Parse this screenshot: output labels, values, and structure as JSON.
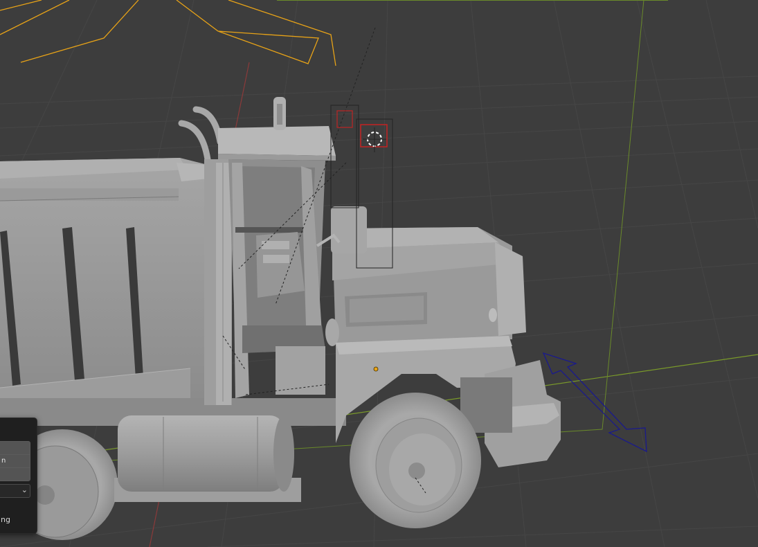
{
  "app": "3D viewport",
  "viewport": {
    "background": "#3d3d3d",
    "grid_color": "#4a4a4a",
    "x_axis_color": "#7a9a2a",
    "y_axis_color": "#8b3a3a",
    "selection_color": "#e8a317",
    "gizmo_color": "#1a1a8c"
  },
  "operator_panel": {
    "field_text": "n",
    "label_text": "ng",
    "select_chevron": "⌄"
  },
  "icons": {
    "camera": "camera-wireframe-icon",
    "light": "spot-light-icon",
    "cursor": "3d-cursor-icon",
    "origin": "origin-dot-icon",
    "direction": "direction-arrow-gizmo-icon"
  }
}
